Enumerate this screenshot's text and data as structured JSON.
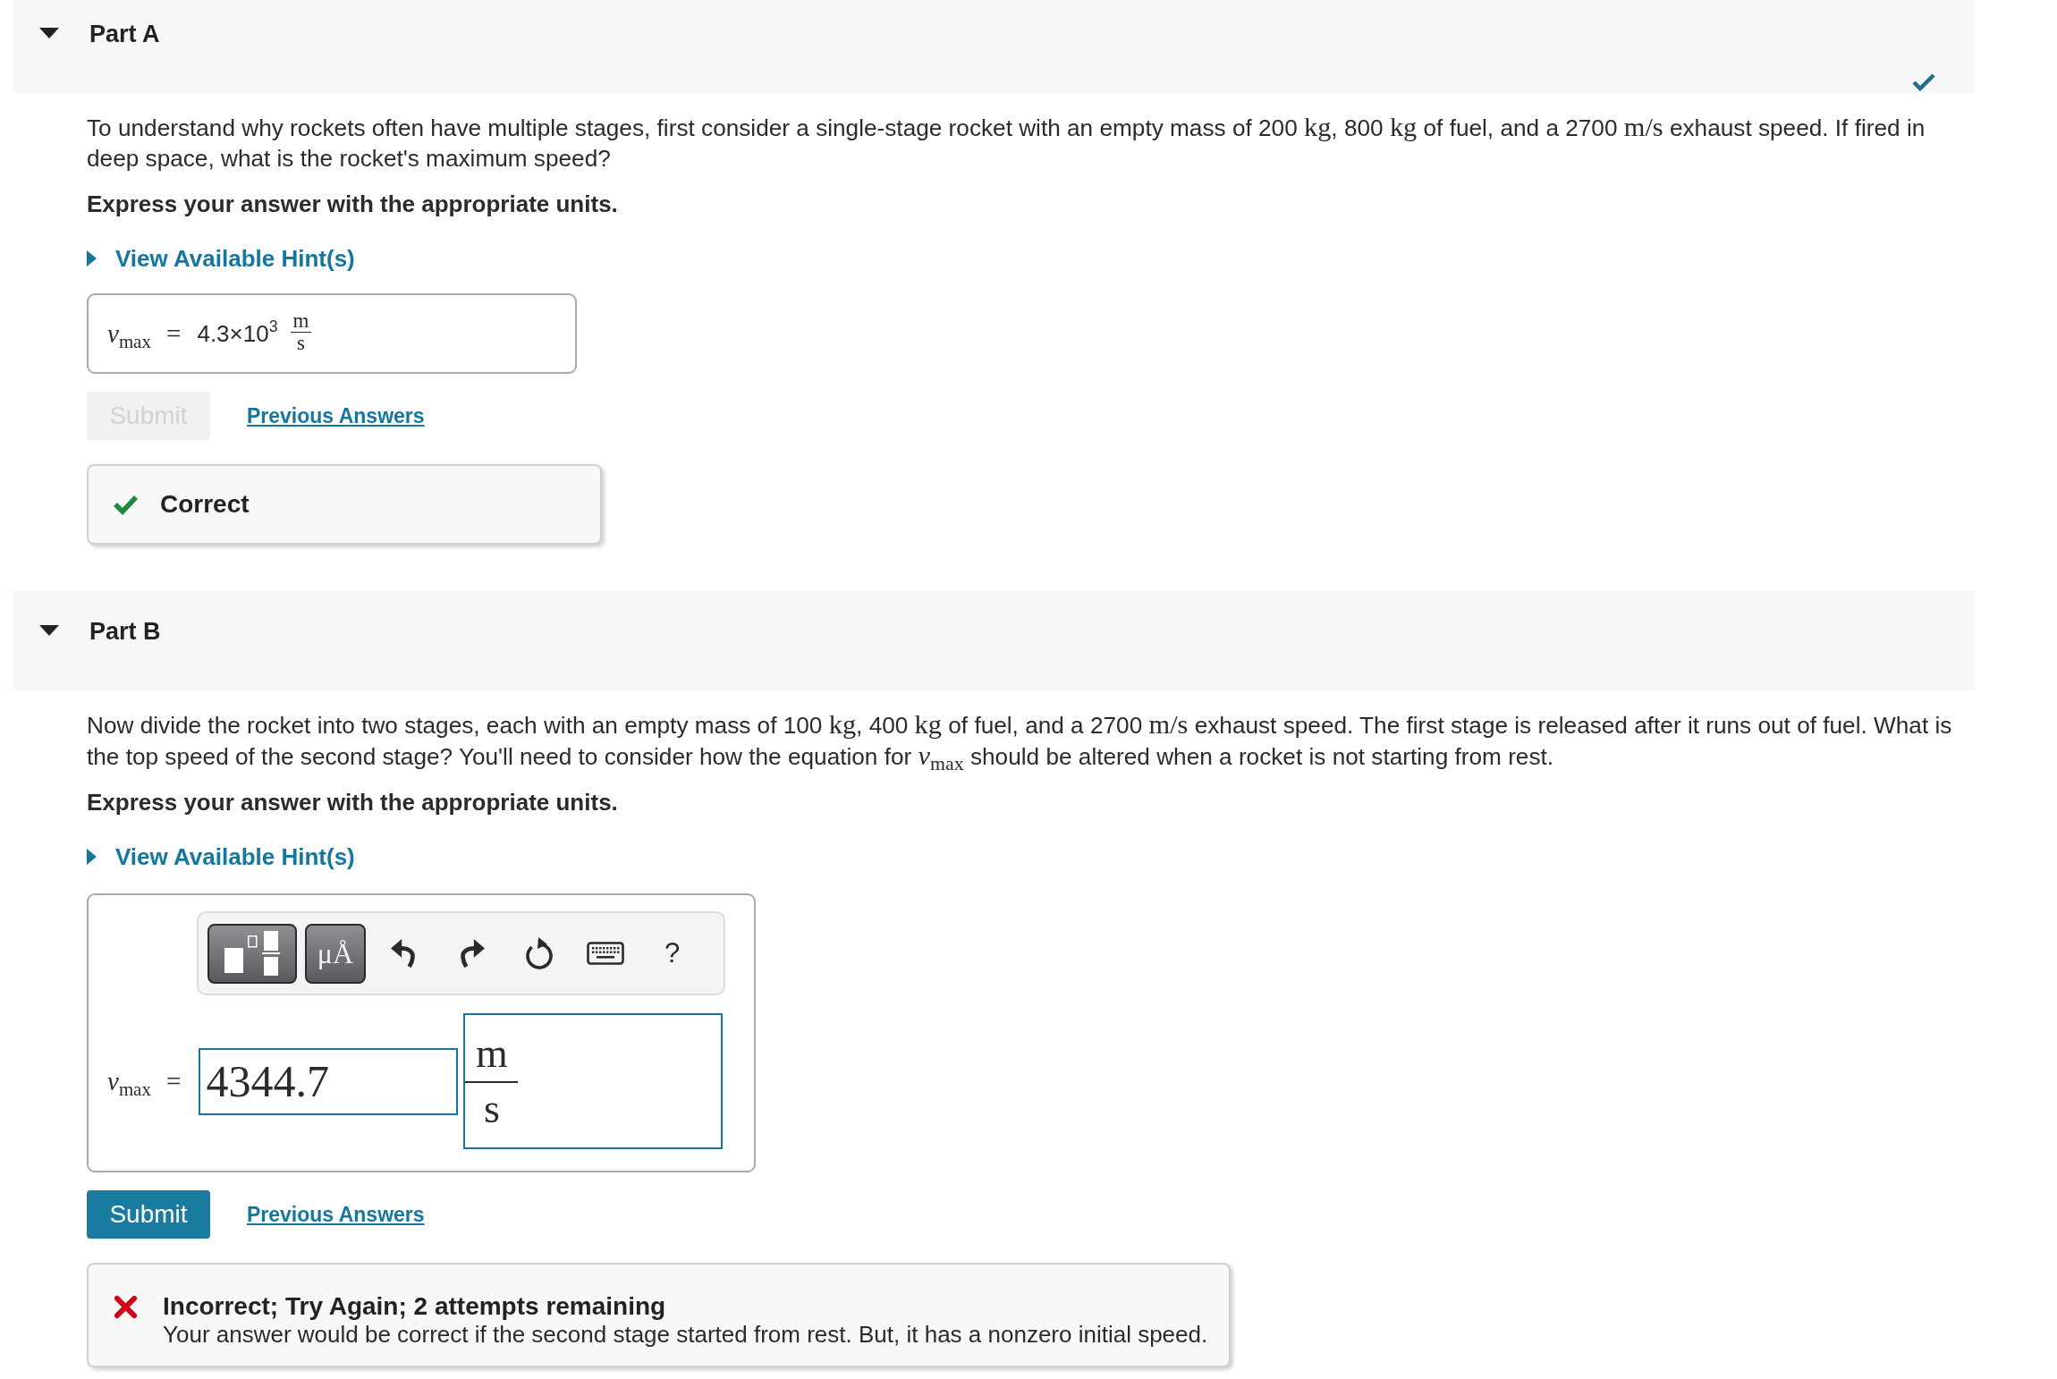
{
  "parts": [
    {
      "title": "Part A",
      "expanded": true,
      "completed": true,
      "question": [
        {
          "kind": "text",
          "text": "To understand why rockets often have multiple stages, first consider a single-stage rocket with an empty mass of 200 "
        },
        {
          "kind": "math",
          "text": "kg"
        },
        {
          "kind": "text",
          "text": ", 800 "
        },
        {
          "kind": "math",
          "text": "kg"
        },
        {
          "kind": "text",
          "text": " of fuel, and a 2700 "
        },
        {
          "kind": "math",
          "text": "m/s"
        },
        {
          "kind": "text",
          "text": " exhaust speed. If fired in deep space, what is the rocket's maximum speed?"
        }
      ],
      "instruction": "Express your answer with the appropriate units.",
      "hint_link": "View Available Hint(s)",
      "answer": {
        "kind": "display",
        "label": "*v*$_{max}$ =",
        "value": "4.3×10$^{3}$",
        "unit": {
          "numerator": "m",
          "denominator": "s"
        }
      },
      "submit": {
        "label": "Submit",
        "disabled": true
      },
      "previous_answers": "Previous Answers",
      "feedback": {
        "kind": "correct",
        "title": "Correct"
      }
    },
    {
      "title": "Part B",
      "expanded": true,
      "completed": false,
      "question": [
        {
          "kind": "text",
          "text": "Now divide the rocket into two stages, each with an empty mass of 100 "
        },
        {
          "kind": "math",
          "text": "kg"
        },
        {
          "kind": "text",
          "text": ", 400 "
        },
        {
          "kind": "math",
          "text": "kg"
        },
        {
          "kind": "text",
          "text": " of fuel, and a 2700 "
        },
        {
          "kind": "math",
          "text": "m/s"
        },
        {
          "kind": "text",
          "text": " exhaust speed. The first stage is released after it runs out of fuel. What is the top speed of the second stage? You'll need to consider how the equation for "
        },
        {
          "kind": "math",
          "text": "*v*$_{max}$"
        },
        {
          "kind": "text",
          "text": " should be altered when a rocket is not starting from rest."
        }
      ],
      "instruction": "Express your answer with the appropriate units.",
      "hint_link": "View Available Hint(s)",
      "answer": {
        "kind": "editor",
        "toolbar": [
          {
            "kind": "templates"
          },
          {
            "kind": "symbols",
            "label": "μÅ"
          },
          {
            "kind": "undo"
          },
          {
            "kind": "redo"
          },
          {
            "kind": "reset"
          },
          {
            "kind": "keyboard"
          },
          {
            "kind": "help",
            "label": "?"
          }
        ],
        "label": "*v*$_{max}$ =",
        "value": "4344.7",
        "unit": {
          "numerator": "m",
          "denominator": "s"
        }
      },
      "submit": {
        "label": "Submit",
        "disabled": false
      },
      "previous_answers": "Previous Answers",
      "feedback": {
        "kind": "incorrect",
        "title": "Incorrect; Try Again; 2 attempts remaining",
        "message": "Your answer would be correct if the second stage started from rest. But, it has a nonzero initial speed."
      }
    }
  ]
}
